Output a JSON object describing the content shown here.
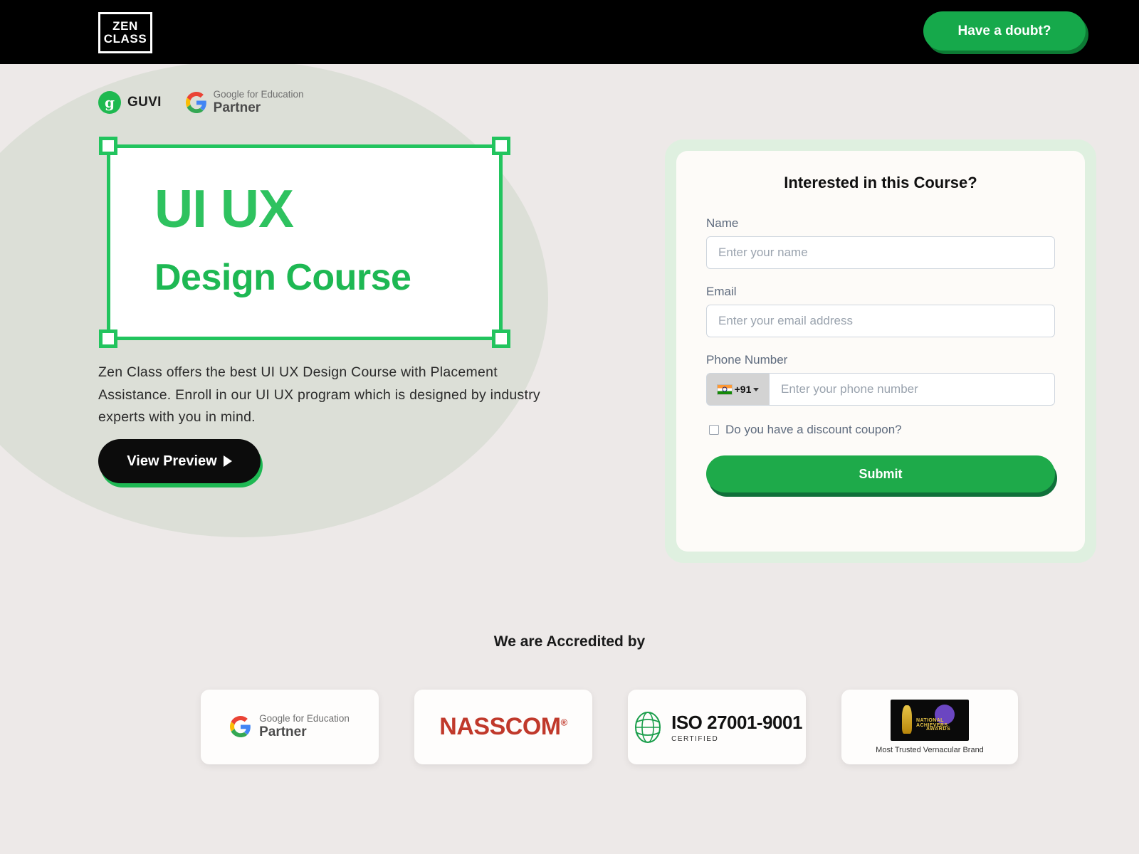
{
  "header": {
    "logo_line1": "ZEN",
    "logo_line2": "CLASS",
    "cta_label": "Have a doubt?"
  },
  "hero": {
    "badges": [
      {
        "icon": "guvi-logo-icon",
        "name": "GUVI"
      },
      {
        "icon": "google-g-icon",
        "line1": "Google for Education",
        "line2": "Partner"
      }
    ],
    "title_line1": "UI UX",
    "title_line2": "Design Course",
    "description": "Zen Class offers the best UI UX Design Course with Placement Assistance. Enroll in our UI UX program which is designed by industry experts with you in mind.",
    "preview_button": "View Preview"
  },
  "form": {
    "title": "Interested in this Course?",
    "name_label": "Name",
    "name_placeholder": "Enter your name",
    "email_label": "Email",
    "email_placeholder": "Enter your email address",
    "phone_label": "Phone Number",
    "phone_country_code": "+91",
    "phone_placeholder": "Enter your phone number",
    "coupon_label": "Do you have a discount coupon?",
    "submit_label": "Submit"
  },
  "accreditation": {
    "title": "We are Accredited by",
    "cards": [
      {
        "id": "google",
        "line1": "Google for Education",
        "line2": "Partner"
      },
      {
        "id": "nasscom",
        "name": "NASSCOM",
        "reg": "®"
      },
      {
        "id": "iso",
        "main": "ISO 27001-9001",
        "sub": "CERTIFIED"
      },
      {
        "id": "award",
        "badge_l1": "NATIONAL ACHIEVERS",
        "badge_l2": "AWARDS",
        "caption": "Most Trusted Vernacular Brand"
      }
    ]
  },
  "colors": {
    "brand_green": "#16a94b",
    "title_green": "#2ec25f",
    "page_bg": "#ede9e8",
    "header_bg": "#000000",
    "nasscom_red": "#c0392b"
  }
}
